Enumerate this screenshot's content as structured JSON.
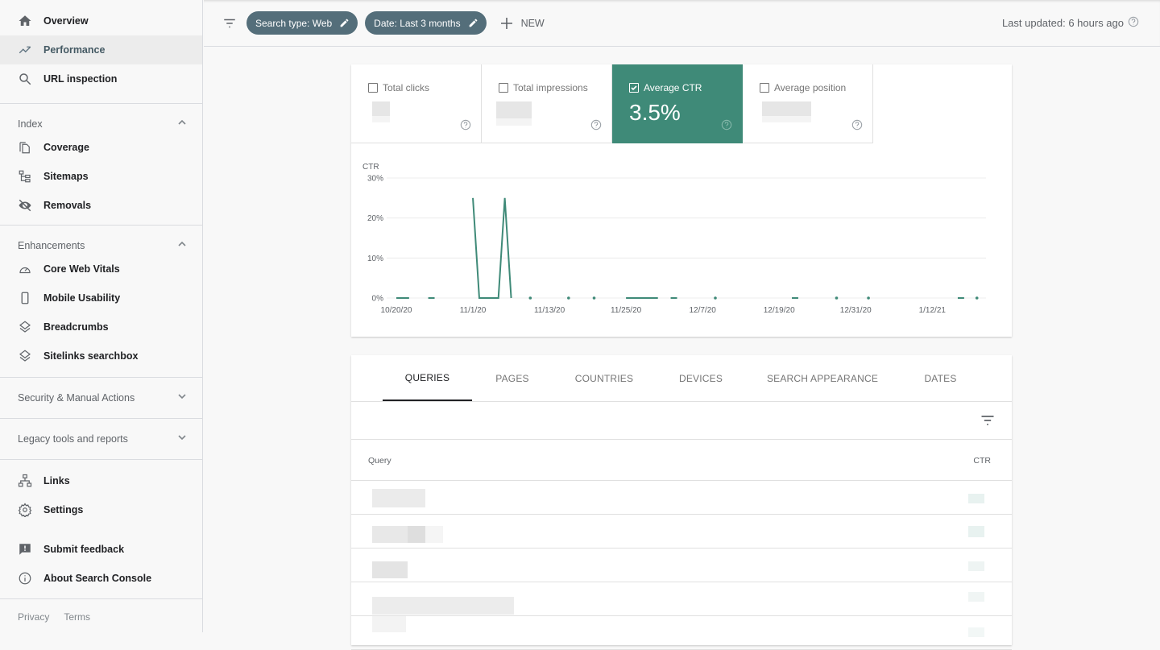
{
  "sidebar": {
    "top_items": [
      {
        "label": "Overview",
        "icon": "home-icon"
      },
      {
        "label": "Performance",
        "icon": "trending-up-icon",
        "active": true
      },
      {
        "label": "URL inspection",
        "icon": "search-icon"
      }
    ],
    "sections": [
      {
        "title": "Index",
        "expanded": true,
        "items": [
          {
            "label": "Coverage",
            "icon": "coverage-icon"
          },
          {
            "label": "Sitemaps",
            "icon": "sitemap-icon"
          },
          {
            "label": "Removals",
            "icon": "eye-off-icon"
          }
        ]
      },
      {
        "title": "Enhancements",
        "expanded": true,
        "items": [
          {
            "label": "Core Web Vitals",
            "icon": "gauge-icon"
          },
          {
            "label": "Mobile Usability",
            "icon": "phone-icon"
          },
          {
            "label": "Breadcrumbs",
            "icon": "layers-icon"
          },
          {
            "label": "Sitelinks searchbox",
            "icon": "layers-icon"
          }
        ]
      },
      {
        "title": "Security & Manual Actions",
        "expanded": false
      },
      {
        "title": "Legacy tools and reports",
        "expanded": false
      }
    ],
    "bottom_items": [
      {
        "label": "Links",
        "icon": "links-icon"
      },
      {
        "label": "Settings",
        "icon": "gear-icon"
      },
      {
        "label": "Submit feedback",
        "icon": "feedback-icon"
      },
      {
        "label": "About Search Console",
        "icon": "info-icon"
      }
    ],
    "footer": {
      "privacy": "Privacy",
      "terms": "Terms"
    }
  },
  "topbar": {
    "chips": [
      "Search type: Web",
      "Date: Last 3 months"
    ],
    "new_label": "NEW",
    "last_updated": "Last updated: 6 hours ago"
  },
  "metrics": [
    {
      "label": "Total clicks",
      "checked": false,
      "value": null
    },
    {
      "label": "Total impressions",
      "checked": false,
      "value": null
    },
    {
      "label": "Average CTR",
      "checked": true,
      "value": "3.5%"
    },
    {
      "label": "Average position",
      "checked": false,
      "value": null
    }
  ],
  "accent_color": "#3f8a78",
  "chip_color": "#546e7a",
  "chart_data": {
    "type": "line",
    "title": "",
    "ylabel": "CTR",
    "xlabel": "",
    "ylim": [
      0,
      30
    ],
    "yticks": [
      "0%",
      "10%",
      "20%",
      "30%"
    ],
    "ytick_values": [
      0,
      10,
      20,
      30
    ],
    "xticks": [
      "10/20/20",
      "11/1/20",
      "11/13/20",
      "11/25/20",
      "12/7/20",
      "12/19/20",
      "12/31/20",
      "1/12/21"
    ],
    "x_start": "10/20/20",
    "grid": true,
    "series": [
      {
        "name": "CTR",
        "color": "#3f8a78",
        "segments": [
          [
            [
              0,
              0
            ],
            [
              2,
              0
            ]
          ],
          [
            [
              5,
              0
            ],
            [
              6,
              0
            ]
          ],
          [
            [
              12,
              25
            ],
            [
              13,
              0
            ],
            [
              16,
              0
            ],
            [
              17,
              25
            ],
            [
              18,
              0
            ]
          ],
          [
            [
              21,
              0
            ]
          ],
          [
            [
              27,
              0
            ]
          ],
          [
            [
              31,
              0
            ]
          ],
          [
            [
              36,
              0
            ],
            [
              41,
              0
            ]
          ],
          [
            [
              43,
              0
            ],
            [
              44,
              0
            ]
          ],
          [
            [
              50,
              0
            ]
          ],
          [
            [
              62,
              0
            ],
            [
              63,
              0
            ]
          ],
          [
            [
              69,
              0
            ]
          ],
          [
            [
              74,
              0
            ]
          ],
          [
            [
              88,
              0
            ],
            [
              89,
              0
            ]
          ],
          [
            [
              91,
              0
            ]
          ]
        ]
      }
    ],
    "x_unit": "days since 10/20/20"
  },
  "table": {
    "tabs": [
      "QUERIES",
      "PAGES",
      "COUNTRIES",
      "DEVICES",
      "SEARCH APPEARANCE",
      "DATES"
    ],
    "active_tab": 0,
    "columns": [
      "Query",
      "CTR"
    ],
    "rows_visible": 5
  }
}
